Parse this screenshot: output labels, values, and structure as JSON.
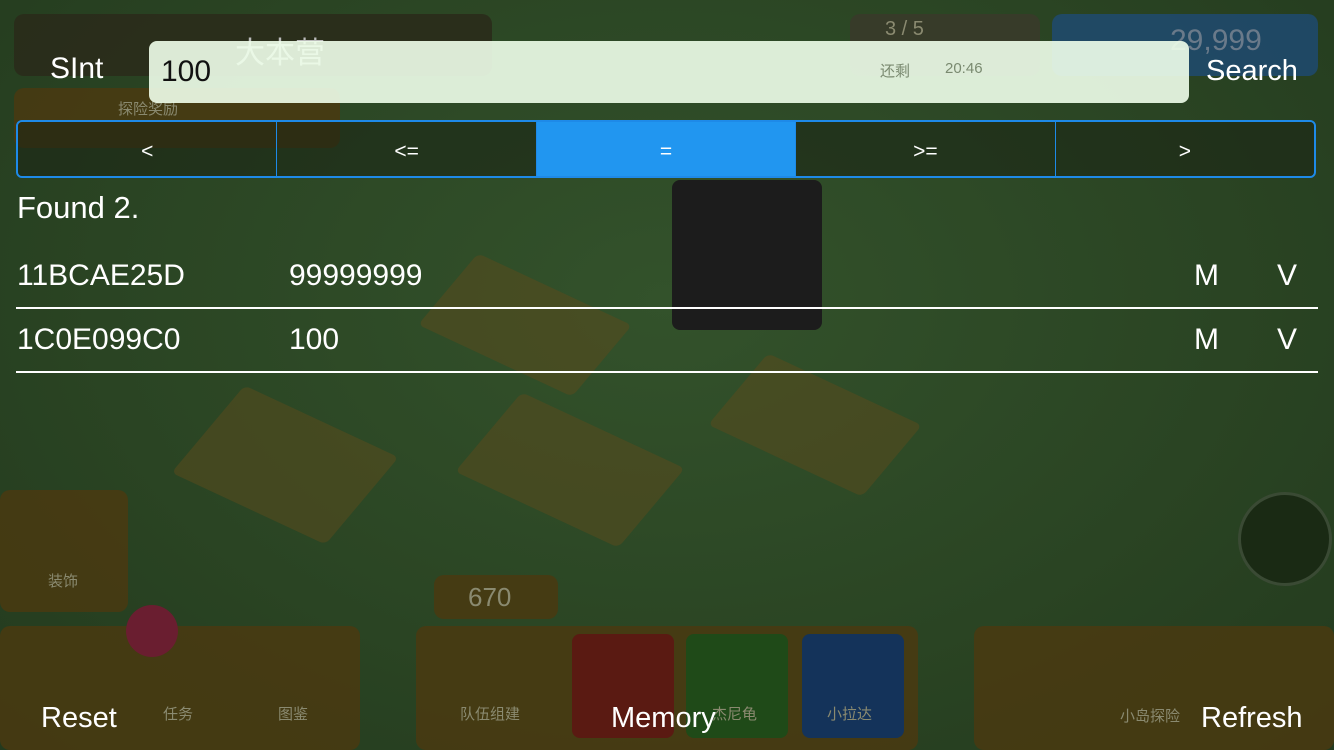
{
  "search": {
    "type_label": "SInt",
    "value": "100",
    "button": "Search"
  },
  "comparators": [
    {
      "label": "<",
      "active": false
    },
    {
      "label": "<=",
      "active": false
    },
    {
      "label": "=",
      "active": true
    },
    {
      "label": ">=",
      "active": false
    },
    {
      "label": ">",
      "active": false
    }
  ],
  "results": {
    "status": "Found 2.",
    "rows": [
      {
        "address": "11BCAE25D",
        "value": "99999999",
        "modify": "M",
        "view": "V"
      },
      {
        "address": "1C0E099C0",
        "value": "100",
        "modify": "M",
        "view": "V"
      }
    ]
  },
  "bottom": {
    "reset": "Reset",
    "memory": "Memory",
    "refresh": "Refresh"
  },
  "game_background": {
    "base_name": "大本营",
    "expedition_reward": "探险奖励",
    "battery": "3 / 5",
    "remaining": "还剩",
    "timer": "20:46",
    "currency": "29,999",
    "decorate": "装饰",
    "count": "670",
    "tasks": "任务",
    "pokedex": "图鉴",
    "team": "队伍组建",
    "pokemon2": "杰尼龟",
    "pokemon3": "小拉达",
    "island": "小岛探险"
  },
  "colors": {
    "accent": "#2196f0",
    "overlay_bg": "#2b4424"
  }
}
